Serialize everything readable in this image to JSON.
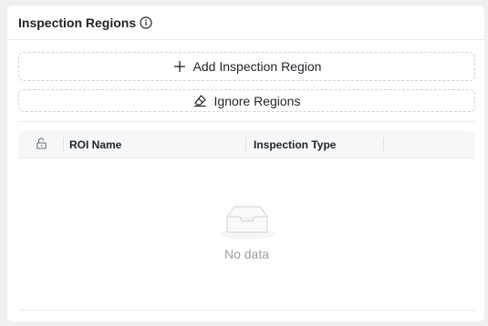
{
  "panel": {
    "title": "Inspection Regions",
    "info_icon": "info-circle-icon"
  },
  "actions": {
    "add_label": "Add Inspection Region",
    "add_icon": "plus-icon",
    "ignore_label": "Ignore Regions",
    "ignore_icon": "eraser-icon"
  },
  "table": {
    "lock_icon": "unlock-icon",
    "columns": [
      "ROI Name",
      "Inspection Type"
    ],
    "rows": [],
    "empty_text": "No data"
  },
  "colors": {
    "page_bg": "#eef0f2",
    "card_bg": "#ffffff",
    "header_bg": "#f6f7f8",
    "muted_text": "#9aa0a6",
    "dashed_border": "#d0d3d7"
  }
}
